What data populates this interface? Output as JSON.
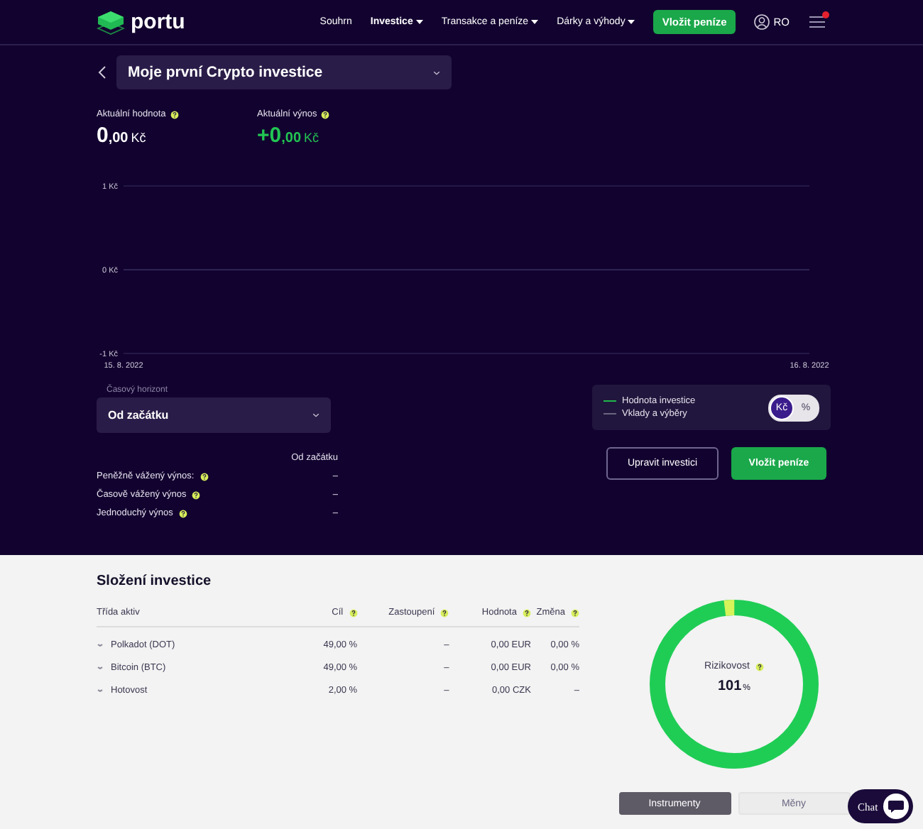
{
  "header": {
    "logo": "portu",
    "nav": [
      {
        "label": "Souhrn",
        "selected": false,
        "dropdown": false
      },
      {
        "label": "Investice",
        "selected": true,
        "dropdown": true
      },
      {
        "label": "Transakce a peníze",
        "selected": false,
        "dropdown": true
      },
      {
        "label": "Dárky a výhody",
        "selected": false,
        "dropdown": true
      }
    ],
    "cta": "Vložit peníze",
    "user": "RO",
    "notification": true
  },
  "portfolio": {
    "title": "Moje první Crypto investice"
  },
  "stats": [
    {
      "label": "Aktuální hodnota",
      "whole": "0",
      "decimals": ",00",
      "currency": "Kč",
      "positive": false
    },
    {
      "label": "Aktuální výnos",
      "whole": "+0",
      "decimals": ",00",
      "currency": "Kč",
      "positive": true
    }
  ],
  "chart": {
    "chart_data": {
      "type": "line",
      "categories": [
        "15. 8. 2022",
        "16. 8. 2022"
      ],
      "ylim": [
        -1,
        1
      ],
      "series": [
        {
          "values": [
            0,
            0
          ]
        }
      ],
      "yticks": [
        {
          "value": 1,
          "label": "1 Kč"
        },
        {
          "value": 0,
          "label": "0 Kč"
        },
        {
          "value": -1,
          "label": "-1 Kč"
        }
      ]
    }
  },
  "horizon": {
    "label": "Časový horizont",
    "value": "Od začátku"
  },
  "legend": [
    {
      "label": "Hodnota investice",
      "color": "#1fb84a"
    },
    {
      "label": "Vklady a výběry",
      "color": "#6b6580"
    }
  ],
  "unit_toggle": [
    {
      "label": "Kč",
      "selected": true
    },
    {
      "label": "%",
      "selected": false
    }
  ],
  "returns": {
    "column": "Od začátku",
    "rows": [
      {
        "label": "Peněžně vážený výnos:",
        "value": "–"
      },
      {
        "label": "Časově vážený výnos",
        "value": "–"
      },
      {
        "label": "Jednoduchý výnos",
        "value": "–"
      }
    ]
  },
  "actions": [
    {
      "label": "Upravit investici",
      "kind": "outline"
    },
    {
      "label": "Vložit peníze",
      "kind": "primary"
    }
  ],
  "composition": {
    "title": "Složení investice",
    "columns": [
      {
        "label": "Třída aktiv",
        "help": false
      },
      {
        "label": "Cíl",
        "help": true
      },
      {
        "label": "Zastoupení",
        "help": true
      },
      {
        "label": "Hodnota",
        "help": true
      },
      {
        "label": "Změna",
        "help": true
      }
    ],
    "rows": [
      {
        "expanded": false,
        "cells": [
          "Polkadot (DOT)",
          "49,00 %",
          "–",
          "0,00 EUR",
          "0,00 %"
        ]
      },
      {
        "expanded": false,
        "cells": [
          "Bitcoin (BTC)",
          "49,00 %",
          "–",
          "0,00 EUR",
          "0,00 %"
        ]
      },
      {
        "expanded": false,
        "cells": [
          "Hotovost",
          "2,00 %",
          "–",
          "0,00 CZK",
          "–"
        ]
      }
    ]
  },
  "risk": {
    "label": "Rizikovost",
    "value": "101",
    "unit": "%"
  },
  "view_tabs": [
    {
      "label": "Instrumenty",
      "selected": true
    },
    {
      "label": "Měny",
      "selected": false
    }
  ],
  "chat": {
    "label": "Chat"
  }
}
